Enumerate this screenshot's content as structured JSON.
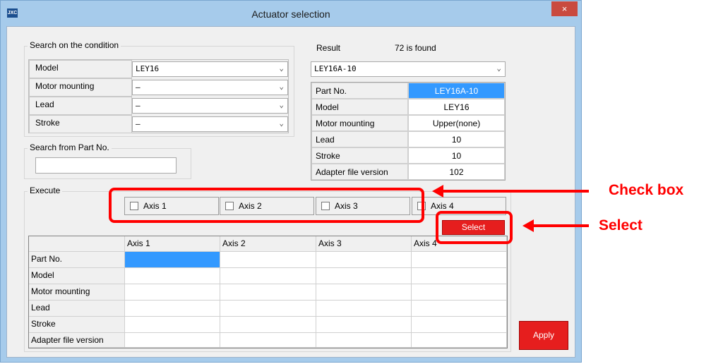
{
  "window": {
    "title": "Actuator selection",
    "app_icon": "JXC",
    "close_glyph": "×"
  },
  "search_condition": {
    "label": "Search on the condition",
    "rows": [
      {
        "name": "Model",
        "value": "LEY16"
      },
      {
        "name": "Motor mounting",
        "value": "–"
      },
      {
        "name": "Lead",
        "value": "–"
      },
      {
        "name": "Stroke",
        "value": "–"
      }
    ]
  },
  "search_part": {
    "label": "Search from Part No.",
    "value": ""
  },
  "result": {
    "label": "Result",
    "count_text": "72 is found",
    "selected": "LEY16A-10",
    "rows": [
      {
        "key": "Part No.",
        "value": "LEY16A-10"
      },
      {
        "key": "Model",
        "value": "LEY16"
      },
      {
        "key": "Motor mounting",
        "value": "Upper(none)"
      },
      {
        "key": "Lead",
        "value": "10"
      },
      {
        "key": "Stroke",
        "value": "10"
      },
      {
        "key": "Adapter file version",
        "value": "102"
      }
    ]
  },
  "execute": {
    "label": "Execute",
    "axes": [
      "Axis 1",
      "Axis 2",
      "Axis 3",
      "Axis 4"
    ],
    "select_label": "Select"
  },
  "grid": {
    "columns": [
      "Axis 1",
      "Axis 2",
      "Axis 3",
      "Axis 4"
    ],
    "row_labels": [
      "Part No.",
      "Model",
      "Motor mounting",
      "Lead",
      "Stroke",
      "Adapter file version"
    ]
  },
  "apply_label": "Apply",
  "annotations": {
    "checkbox": "Check box",
    "select": "Select"
  },
  "colors": {
    "accent_red": "#e61e1e",
    "selection_blue": "#3399ff",
    "callout_red": "#ff0000"
  }
}
